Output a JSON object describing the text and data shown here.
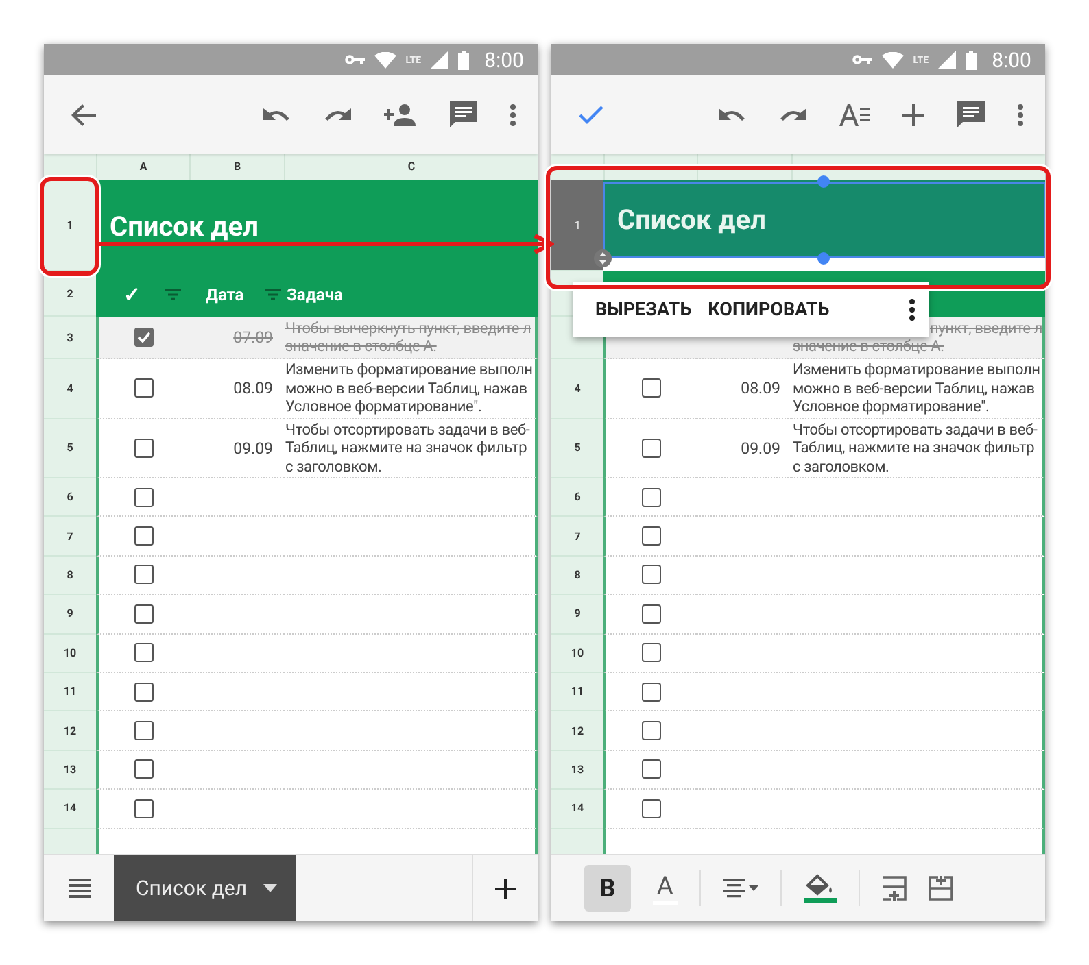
{
  "screens": [
    {
      "status": {
        "network": "LTE",
        "time": "8:00"
      },
      "toolbar": {
        "kind": "view"
      },
      "column_headers": [
        "A",
        "B",
        "C"
      ],
      "title_row": {
        "number": "1",
        "text": "Список дел",
        "selected": false
      },
      "header_row": {
        "number": "2",
        "check": "✓",
        "date": "Дата",
        "task": "Задача"
      },
      "rows": [
        {
          "number": "3",
          "checked": true,
          "done": true,
          "date": "07.09",
          "lines": [
            "Чтобы вычеркнуть пункт, введите л",
            "значение в столбце А."
          ]
        },
        {
          "number": "4",
          "checked": false,
          "done": false,
          "date": "08.09",
          "lines": [
            "Изменить форматирование выполн",
            "можно в веб-версии Таблиц, нажав",
            "Условное форматирование\"."
          ]
        },
        {
          "number": "5",
          "checked": false,
          "done": false,
          "date": "09.09",
          "lines": [
            "Чтобы отсортировать задачи в веб-",
            "Таблиц, нажмите на значок фильтр",
            "с заголовком."
          ]
        },
        {
          "number": "6",
          "checked": false
        },
        {
          "number": "7",
          "checked": false
        },
        {
          "number": "8",
          "checked": false
        },
        {
          "number": "9",
          "checked": false
        },
        {
          "number": "10",
          "checked": false
        },
        {
          "number": "11",
          "checked": false
        },
        {
          "number": "12",
          "checked": false
        },
        {
          "number": "13",
          "checked": false
        },
        {
          "number": "14",
          "checked": false
        }
      ],
      "bottom_bar": {
        "kind": "sheets",
        "tab": "Список дел"
      }
    },
    {
      "status": {
        "network": "LTE",
        "time": "8:00"
      },
      "toolbar": {
        "kind": "edit"
      },
      "title_row": {
        "number": "1",
        "text": "Список дел",
        "selected": true
      },
      "rows": [
        {
          "kind": "covered",
          "done": true,
          "lines": [
            "пункт, введите л",
            "значение в столбце А."
          ]
        },
        {
          "number": "4",
          "checked": false,
          "done": false,
          "date": "08.09",
          "lines": [
            "Изменить форматирование выполн",
            "можно в веб-версии Таблиц, нажав",
            "Условное форматирование\"."
          ]
        },
        {
          "number": "5",
          "checked": false,
          "done": false,
          "date": "09.09",
          "lines": [
            "Чтобы отсортировать задачи в веб-",
            "Таблиц, нажмите на значок фильтр",
            "с заголовком."
          ]
        },
        {
          "number": "6",
          "checked": false
        },
        {
          "number": "7",
          "checked": false
        },
        {
          "number": "8",
          "checked": false
        },
        {
          "number": "9",
          "checked": false
        },
        {
          "number": "10",
          "checked": false
        },
        {
          "number": "11",
          "checked": false
        },
        {
          "number": "12",
          "checked": false
        },
        {
          "number": "13",
          "checked": false
        },
        {
          "number": "14",
          "checked": false
        }
      ],
      "context_menu": {
        "items": [
          "ВЫРЕЗАТЬ",
          "КОПИРОВАТЬ"
        ]
      },
      "bottom_bar": {
        "kind": "format",
        "bold_label": "B",
        "bold_selected": true,
        "color_label": "A"
      }
    }
  ]
}
